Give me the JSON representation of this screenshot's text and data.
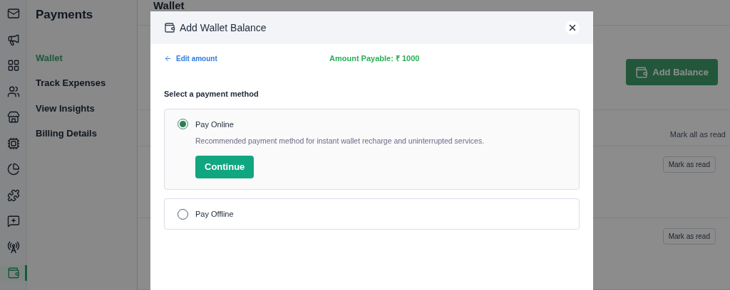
{
  "icon_rail": {
    "items": [
      {
        "kind": "mail",
        "selected": false
      },
      {
        "kind": "megaphone",
        "selected": false
      },
      {
        "kind": "grid",
        "selected": false
      },
      {
        "kind": "users",
        "selected": false
      },
      {
        "kind": "store",
        "selected": false
      },
      {
        "kind": "chip",
        "selected": false
      },
      {
        "kind": "pie",
        "selected": false
      },
      {
        "kind": "puzzle",
        "selected": false
      },
      {
        "kind": "message",
        "selected": false
      },
      {
        "kind": "tower",
        "selected": false
      },
      {
        "kind": "wallet",
        "selected": true
      }
    ]
  },
  "sidebar": {
    "title": "Payments",
    "items": [
      {
        "label": "Wallet",
        "selected": true
      },
      {
        "label": "Track Expenses",
        "selected": false
      },
      {
        "label": "View Insights",
        "selected": false
      },
      {
        "label": "Billing Details",
        "selected": false
      }
    ]
  },
  "main": {
    "title": "Wallet",
    "add_button": "Add Balance",
    "mark_all": "Mark all as read",
    "notifications": [
      {
        "action": "Mark as read"
      },
      {
        "action": "Mark as read"
      }
    ]
  },
  "modal": {
    "title": "Add Wallet Balance",
    "back_link": "Edit amount",
    "amount": "Amount Payable: ₹ 1000",
    "section_title": "Select a payment method",
    "options": [
      {
        "label": "Pay Online",
        "selected": true,
        "description": "Recommended payment method for instant wallet recharge and uninterrupted services.",
        "button": "Continue"
      },
      {
        "label": "Pay Offline",
        "selected": false
      }
    ]
  }
}
